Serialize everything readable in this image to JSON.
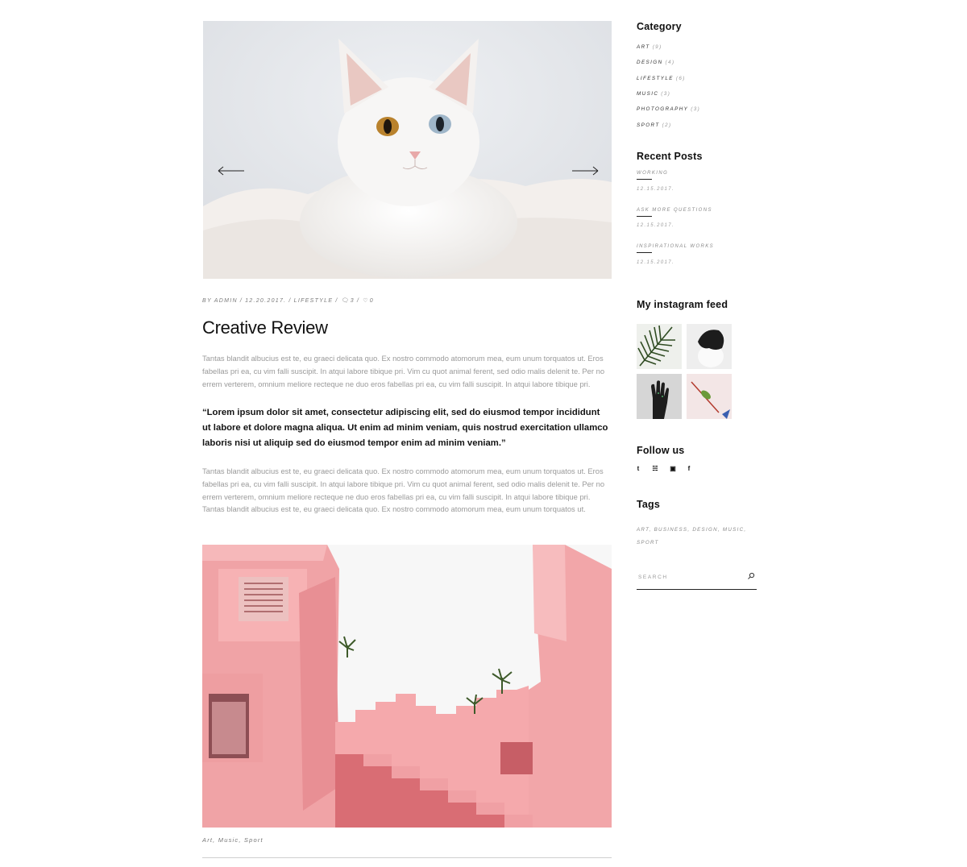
{
  "post": {
    "meta": {
      "author": "BY ADMIN",
      "date": "12.20.2017.",
      "category": "LIFESTYLE",
      "comments": "3",
      "likes": "0"
    },
    "title": "Creative Review",
    "paragraph1": "Tantas blandit albucius est te, eu graeci delicata quo. Ex nostro commodo atomorum mea, eum unum torquatos ut. Eros fabellas pri ea, cu vim falli suscipit. In atqui labore tibique pri. Vim cu quot animal ferent, sed odio malis delenit te. Per no errem verterem, omnium meliore recteque ne duo eros fabellas pri ea, cu vim falli suscipit. In atqui labore tibique pri.",
    "quote": "“Lorem ipsum dolor sit amet, consectetur adipiscing elit, sed do eiusmod tempor incididunt ut labore et dolore magna aliqua. Ut enim ad minim veniam, quis nostrud exercitation ullamco laboris nisi ut aliquip sed do eiusmod tempor enim ad minim veniam.”",
    "paragraph2": "Tantas blandit albucius est te, eu graeci delicata quo. Ex nostro commodo atomorum mea, eum unum torquatos ut. Eros fabellas pri ea, cu vim falli suscipit. In atqui labore tibique pri. Vim cu quot animal ferent, sed odio malis delenit te. Per no errem verterem, omnium meliore recteque ne duo eros fabellas pri ea, cu vim falli suscipit. In atqui labore tibique pri. Tantas blandit albucius est te, eu graeci delicata quo. Ex nostro commodo atomorum mea, eum unum torquatos ut.",
    "tags": "Art, Music, Sport"
  },
  "sidebar": {
    "category": {
      "title": "Category",
      "items": [
        {
          "label": "ART",
          "count": "(9)"
        },
        {
          "label": "DESIGN",
          "count": "(4)"
        },
        {
          "label": "LIFESTYLE",
          "count": "(6)"
        },
        {
          "label": "MUSIC",
          "count": "(3)"
        },
        {
          "label": "PHOTOGRAPHY",
          "count": "(3)"
        },
        {
          "label": "SPORT",
          "count": "(2)"
        }
      ]
    },
    "recent_posts": {
      "title": "Recent Posts",
      "items": [
        {
          "title": "WORKING",
          "date": "12.15.2017."
        },
        {
          "title": "ASK MORE QUESTIONS",
          "date": "12.15.2017."
        },
        {
          "title": "INSPIRATIONAL WORKS",
          "date": "12.15.2017."
        }
      ]
    },
    "instagram": {
      "title": "My instagram feed"
    },
    "follow": {
      "title": "Follow us",
      "icons": [
        "tumblr-icon",
        "twitter-icon",
        "instagram-icon",
        "facebook-icon"
      ],
      "glyphs": [
        "t",
        "☵",
        "▣",
        "f"
      ]
    },
    "tags": {
      "title": "Tags",
      "text": "ART, BUSINESS, DESIGN, MUSIC, SPORT"
    },
    "search": {
      "placeholder": "SEARCH"
    }
  },
  "colors": {
    "text": "#111111",
    "muted": "#9a9a9a",
    "building_pink": "#e8848a"
  }
}
